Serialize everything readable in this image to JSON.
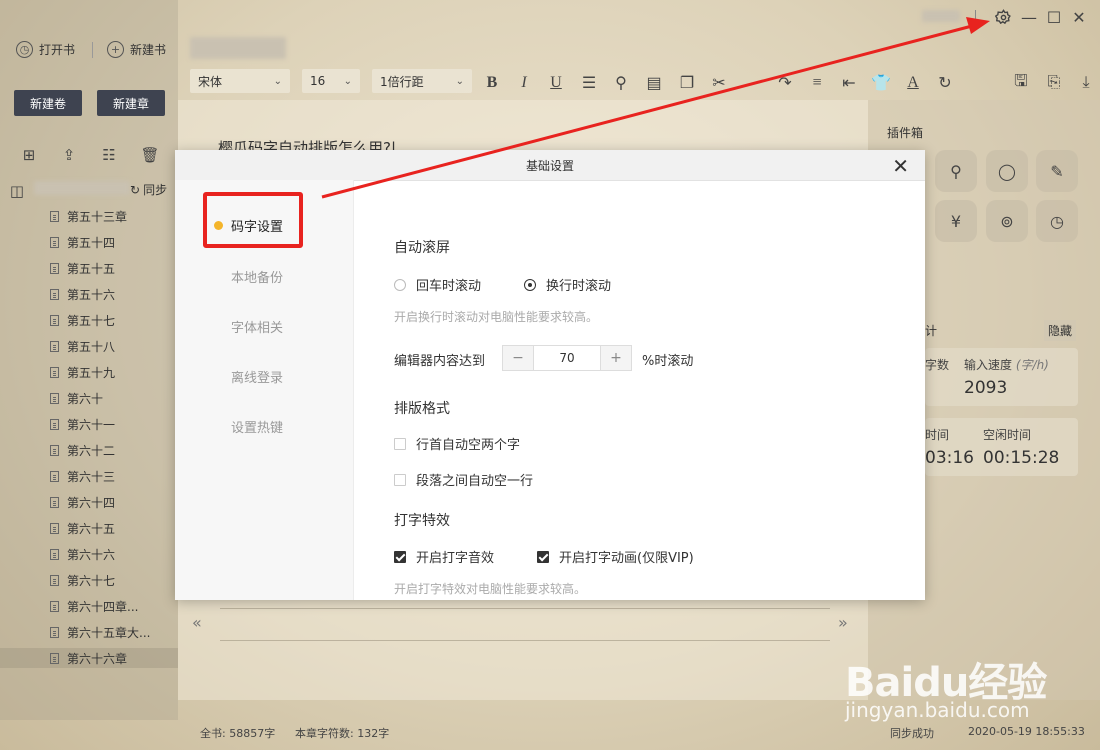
{
  "window": {
    "settings_icon": "gear-icon",
    "minimize_icon": "minimize-icon",
    "maximize_icon": "maximize-icon",
    "close_icon": "close-icon"
  },
  "top_bar": {
    "open_book": "打开书",
    "new_book": "新建书"
  },
  "left_panel": {
    "new_volume": "新建卷",
    "new_chapter": "新建章",
    "sync_label": "同步",
    "chapters": [
      {
        "label": "第五十三章"
      },
      {
        "label": "第五十四"
      },
      {
        "label": "第五十五"
      },
      {
        "label": "第五十六"
      },
      {
        "label": "第五十七"
      },
      {
        "label": "第五十八"
      },
      {
        "label": "第五十九"
      },
      {
        "label": "第六十"
      },
      {
        "label": "第六十一"
      },
      {
        "label": "第六十二"
      },
      {
        "label": "第六十三"
      },
      {
        "label": "第六十四"
      },
      {
        "label": "第六十五"
      },
      {
        "label": "第六十六"
      },
      {
        "label": "第六十七"
      },
      {
        "label": "第六十四章..."
      },
      {
        "label": "第六十五章大..."
      },
      {
        "label": "第六十六章"
      }
    ]
  },
  "toolbar": {
    "font": "宋体",
    "size": "16",
    "line_spacing": "1倍行距"
  },
  "editor": {
    "title_text": "樱瓜码字自动排版怎么用?|"
  },
  "right_panel": {
    "plugin_box": "插件箱",
    "stats_label": "计",
    "hide": "隐藏",
    "word_count_label": "字数",
    "input_speed_label": "输入速度",
    "input_speed_unit": "(字/h)",
    "input_speed_value": "2093",
    "time_label": "时间",
    "time_value": "03:16",
    "idle_time_label": "空闲时间",
    "idle_time_value": "00:15:28"
  },
  "dialog": {
    "title": "基础设置",
    "nav": [
      "码字设置",
      "本地备份",
      "字体相关",
      "离线登录",
      "设置热键"
    ],
    "auto_scroll": {
      "title": "自动滚屏",
      "option1": "回车时滚动",
      "option2": "换行时滚动",
      "selected": "换行时滚动",
      "hint": "开启换行时滚动对电脑性能要求较高。",
      "editor_reach_label": "编辑器内容达到",
      "editor_reach_value": "70",
      "editor_reach_suffix": "%时滚动"
    },
    "format": {
      "title": "排版格式",
      "option1": "行首自动空两个字",
      "option2": "段落之间自动空一行"
    },
    "typing_effect": {
      "title": "打字特效",
      "option1": "开启打字音效",
      "option2": "开启打字动画(仅限VIP)",
      "hint": "开启打字特效对电脑性能要求较高。"
    }
  },
  "status_bar": {
    "total": "全书: 58857字",
    "chapter_chars": "本章字符数: 132字",
    "sync_status": "同步成功",
    "datetime": "2020-05-19 18:55:33"
  },
  "watermark": {
    "brand": "Baidu经验",
    "url": "jingyan.baidu.com"
  },
  "colors": {
    "accent_dot": "#f4b52b",
    "annotation_red": "#e8231f",
    "dark_button": "#3e4350"
  }
}
